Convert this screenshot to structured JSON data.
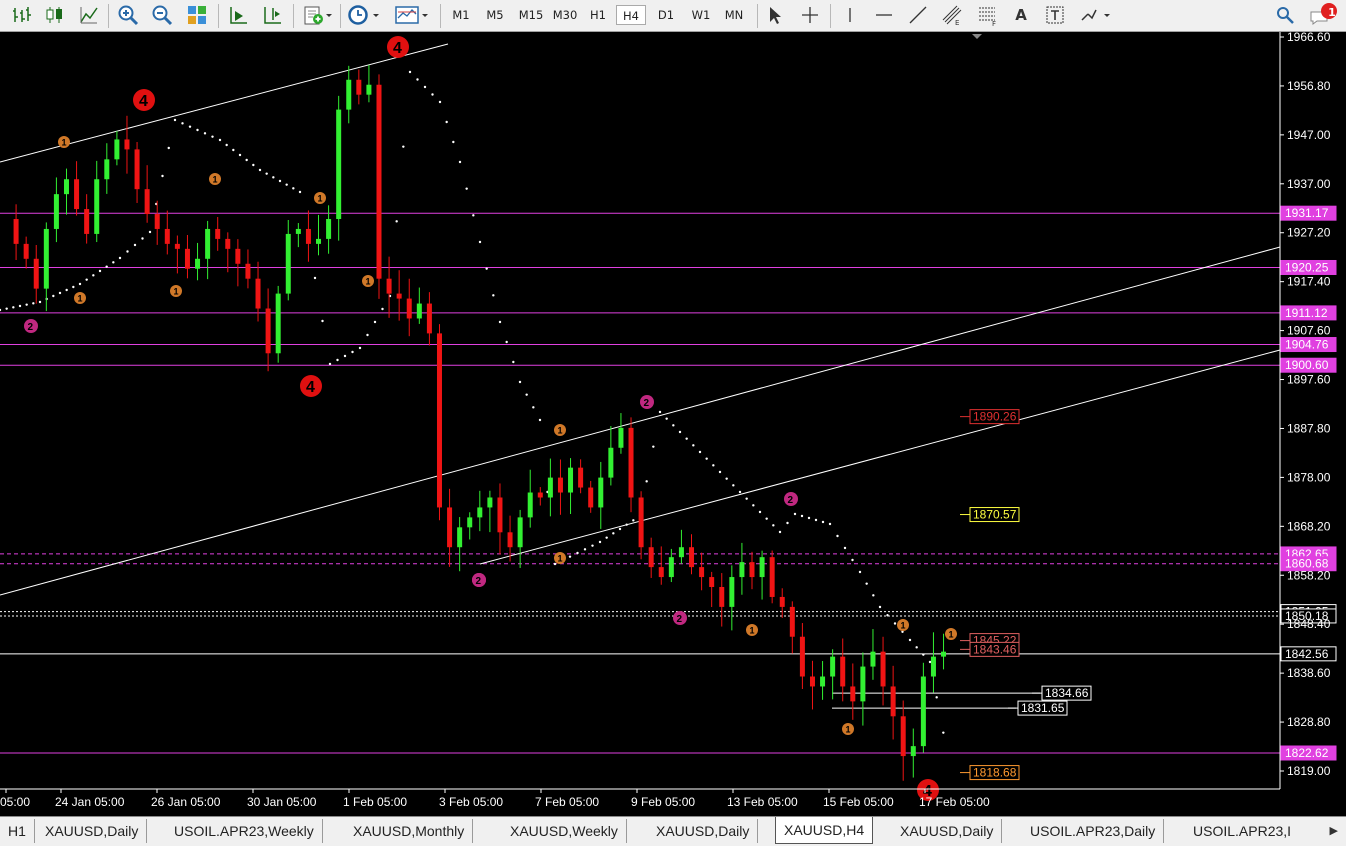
{
  "toolbar": {
    "timeframes": [
      "M1",
      "M5",
      "M15",
      "M30",
      "H1",
      "H4",
      "D1",
      "W1",
      "MN"
    ],
    "active_timeframe": "H4",
    "text_tool": "A",
    "notification_count": "1"
  },
  "chart": {
    "symbol": "XAUUSD",
    "period": "H4",
    "price_axis": [
      "1966.60",
      "1956.80",
      "1947.00",
      "1937.00",
      "1927.20",
      "1917.40",
      "1907.60",
      "1897.60",
      "1887.80",
      "1878.00",
      "1868.20",
      "1858.20",
      "1848.40",
      "1838.60",
      "1828.80",
      "1819.00"
    ],
    "time_axis": [
      "05:00",
      "24 Jan 05:00",
      "26 Jan 05:00",
      "30 Jan 05:00",
      "1 Feb 05:00",
      "3 Feb 05:00",
      "7 Feb 05:00",
      "9 Feb 05:00",
      "13 Feb 05:00",
      "15 Feb 05:00",
      "17 Feb 05:00"
    ],
    "colors": {
      "bull": "#32f032",
      "bear": "#f01414",
      "level": "#e040e0",
      "trend": "#ffffff",
      "psar": "#ffffff"
    },
    "level_labels": [
      {
        "text": "1931.17",
        "color": "#e040e0"
      },
      {
        "text": "1920.25",
        "color": "#e040e0"
      },
      {
        "text": "1911.12",
        "color": "#e040e0"
      },
      {
        "text": "1904.76",
        "color": "#e040e0"
      },
      {
        "text": "1900.60",
        "color": "#e040e0"
      },
      {
        "text": "1862.65",
        "color": "#e040e0"
      },
      {
        "text": "1860.68",
        "color": "#e040e0"
      },
      {
        "text": "1851.05",
        "color": "#ffffff"
      },
      {
        "text": "1850.18",
        "color": "#ffffff"
      },
      {
        "text": "1842.56",
        "color": "#ffffff"
      },
      {
        "text": "1822.62",
        "color": "#e040e0"
      }
    ],
    "chart_labels": [
      {
        "text": "1890.26",
        "color": "#e03030"
      },
      {
        "text": "1870.57",
        "color": "#ffff40"
      },
      {
        "text": "1845.22",
        "color": "#e06060"
      },
      {
        "text": "1843.46",
        "color": "#e06060"
      },
      {
        "text": "1834.66",
        "color": "#ffffff"
      },
      {
        "text": "1831.65",
        "color": "#ffffff"
      },
      {
        "text": "1818.68",
        "color": "#ff9a30"
      }
    ],
    "wave_markers": [
      "4",
      "4",
      "4",
      "4",
      "1",
      "1",
      "1",
      "1",
      "1",
      "1",
      "1",
      "1",
      "1",
      "1",
      "1",
      "1",
      "2",
      "2",
      "2",
      "2",
      "2",
      "2"
    ]
  },
  "tabs": [
    {
      "label": "H1"
    },
    {
      "label": "XAUUSD,Daily"
    },
    {
      "label": "USOIL.APR23,Weekly"
    },
    {
      "label": "XAUUSD,Monthly"
    },
    {
      "label": "XAUUSD,Weekly"
    },
    {
      "label": "XAUUSD,Daily"
    },
    {
      "label": "XAUUSD,H4"
    },
    {
      "label": "XAUUSD,Daily"
    },
    {
      "label": "USOIL.APR23,Daily"
    },
    {
      "label": "USOIL.APR23,I"
    }
  ],
  "active_tab": "XAUUSD,H4"
}
